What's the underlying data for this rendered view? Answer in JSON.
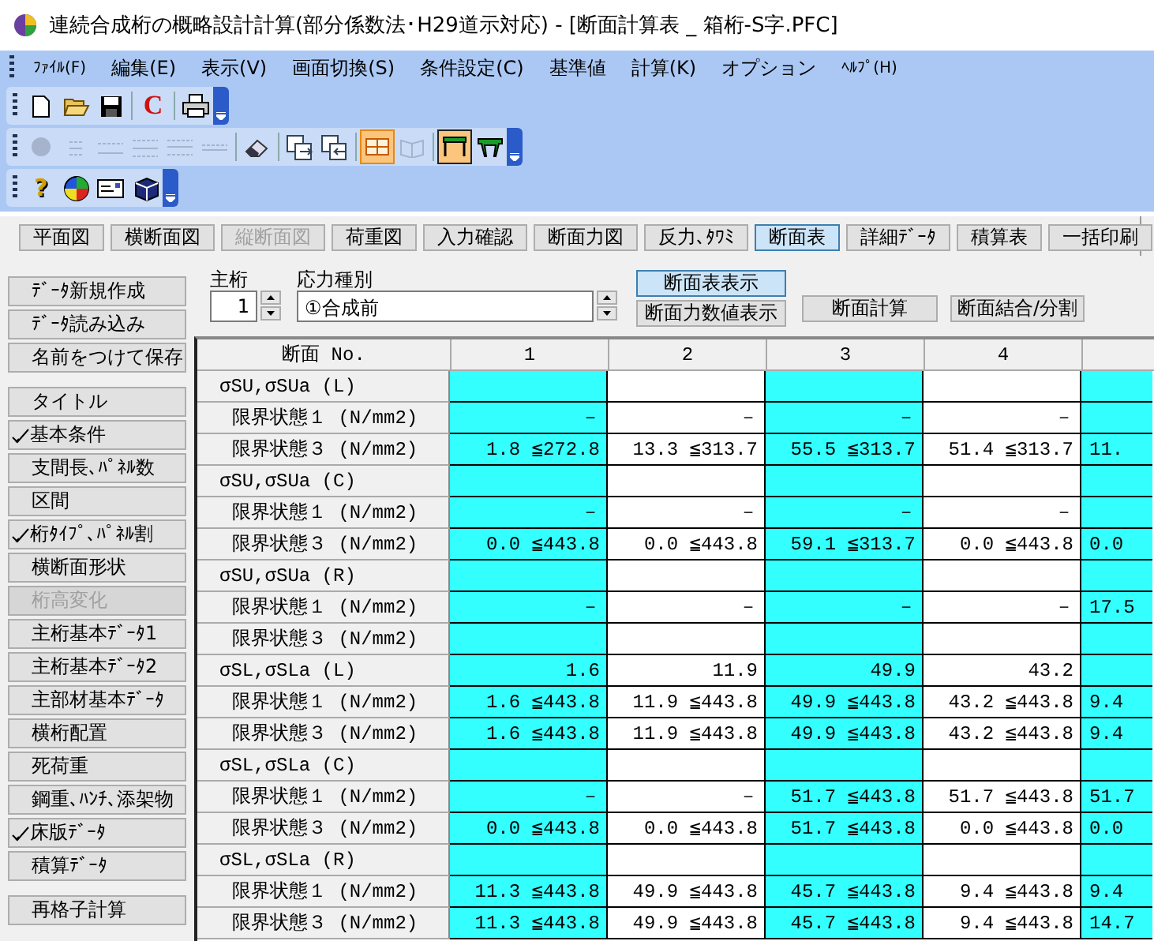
{
  "window": {
    "title": "連続合成桁の概略設計計算(部分係数法･H29道示対応) - [断面計算表 _ 箱桁-S字.PFC]"
  },
  "menu": [
    "ﾌｧｲﾙ(F)",
    "編集(E)",
    "表示(V)",
    "画面切換(S)",
    "条件設定(C)",
    "基準値",
    "計算(K)",
    "オプション",
    "ﾍﾙﾌﾟ(H)"
  ],
  "toolbars": [
    {
      "buttons": [
        {
          "kind": "new",
          "selected": false,
          "disabled": false
        },
        {
          "kind": "open",
          "selected": false,
          "disabled": false
        },
        {
          "kind": "save",
          "selected": false,
          "disabled": false
        },
        {
          "kind": "separator"
        },
        {
          "kind": "letter",
          "text": "C",
          "selected": false,
          "disabled": false
        },
        {
          "kind": "separator"
        },
        {
          "kind": "print",
          "selected": false,
          "disabled": false
        }
      ]
    },
    {
      "buttons": [
        {
          "kind": "circle",
          "selected": false,
          "disabled": true
        },
        {
          "kind": "lines-a",
          "selected": false,
          "disabled": true
        },
        {
          "kind": "lines-b",
          "selected": false,
          "disabled": true
        },
        {
          "kind": "lines-c",
          "selected": false,
          "disabled": true
        },
        {
          "kind": "lines-d",
          "selected": false,
          "disabled": true
        },
        {
          "kind": "lines-e",
          "selected": false,
          "disabled": true
        },
        {
          "kind": "separator"
        },
        {
          "kind": "eraser",
          "selected": false,
          "disabled": false
        },
        {
          "kind": "separator"
        },
        {
          "kind": "export",
          "selected": false,
          "disabled": false
        },
        {
          "kind": "import",
          "selected": false,
          "disabled": false
        },
        {
          "kind": "separator"
        },
        {
          "kind": "table",
          "selected": true,
          "disabled": false
        },
        {
          "kind": "book",
          "selected": false,
          "disabled": true
        },
        {
          "kind": "separator"
        },
        {
          "kind": "frame",
          "selected": true,
          "disabled": false
        },
        {
          "kind": "bridge",
          "selected": false,
          "disabled": false
        }
      ]
    },
    {
      "buttons": [
        {
          "kind": "letter",
          "text": "?",
          "selected": false,
          "disabled": false
        },
        {
          "kind": "palette",
          "selected": false,
          "disabled": false
        },
        {
          "kind": "card",
          "selected": false,
          "disabled": false
        },
        {
          "kind": "cube",
          "selected": false,
          "disabled": false
        }
      ]
    }
  ],
  "tabs": [
    {
      "label": "平面図",
      "selected": false,
      "disabled": false
    },
    {
      "label": "横断面図",
      "selected": false,
      "disabled": false
    },
    {
      "label": "縦断面図",
      "selected": false,
      "disabled": true
    },
    {
      "label": "荷重図",
      "selected": false,
      "disabled": false
    },
    {
      "label": "入力確認",
      "selected": false,
      "disabled": false
    },
    {
      "label": "断面力図",
      "selected": false,
      "disabled": false
    },
    {
      "label": "反力､ﾀﾜﾐ",
      "selected": false,
      "disabled": false
    },
    {
      "label": "断面表",
      "selected": true,
      "disabled": false
    },
    {
      "label": "詳細ﾃﾞｰﾀ",
      "selected": false,
      "disabled": false
    },
    {
      "label": "積算表",
      "selected": false,
      "disabled": false
    },
    {
      "label": "一括印刷",
      "selected": false,
      "disabled": false
    }
  ],
  "sidebar": {
    "groups": [
      [
        {
          "label": "ﾃﾞｰﾀ新規作成",
          "checked": false,
          "disabled": false
        },
        {
          "label": "ﾃﾞｰﾀ読み込み",
          "checked": false,
          "disabled": false
        },
        {
          "label": "名前をつけて保存",
          "checked": false,
          "disabled": false
        }
      ],
      [
        {
          "label": "タイトル",
          "checked": false,
          "disabled": false
        },
        {
          "label": "基本条件",
          "checked": true,
          "disabled": false
        },
        {
          "label": "支間長､ﾊﾟﾈﾙ数",
          "checked": false,
          "disabled": false
        },
        {
          "label": "区間",
          "checked": false,
          "disabled": false
        },
        {
          "label": "桁ﾀｲﾌﾟ､ﾊﾟﾈﾙ割",
          "checked": true,
          "disabled": false
        },
        {
          "label": "横断面形状",
          "checked": false,
          "disabled": false
        },
        {
          "label": "桁高変化",
          "checked": false,
          "disabled": true
        },
        {
          "label": "主桁基本ﾃﾞｰﾀ1",
          "checked": false,
          "disabled": false
        },
        {
          "label": "主桁基本ﾃﾞｰﾀ2",
          "checked": false,
          "disabled": false
        },
        {
          "label": "主部材基本ﾃﾞｰﾀ",
          "checked": false,
          "disabled": false
        },
        {
          "label": "横桁配置",
          "checked": false,
          "disabled": false
        },
        {
          "label": "死荷重",
          "checked": false,
          "disabled": false
        },
        {
          "label": "鋼重､ﾊﾝﾁ､添架物",
          "checked": false,
          "disabled": false
        },
        {
          "label": "床版ﾃﾞｰﾀ",
          "checked": true,
          "disabled": false
        },
        {
          "label": "積算ﾃﾞｰﾀ",
          "checked": false,
          "disabled": false
        }
      ],
      [
        {
          "label": "再格子計算",
          "checked": false,
          "disabled": false
        }
      ]
    ]
  },
  "controls": {
    "girder_label": "主桁",
    "girder_value": "1",
    "stress_label": "応力種別",
    "stress_value": "①合成前",
    "buttons": [
      {
        "label": "断面表表示",
        "selected": true
      },
      {
        "label": "断面力数値表示",
        "selected": false
      },
      {
        "label": "断面計算",
        "selected": false
      },
      {
        "label": "断面結合/分割",
        "selected": false
      }
    ]
  },
  "table": {
    "corner": "断面 No.",
    "columns": [
      {
        "label": "1",
        "shaded": true
      },
      {
        "label": "2",
        "shaded": false
      },
      {
        "label": "3",
        "shaded": true
      },
      {
        "label": "4",
        "shaded": false
      },
      {
        "shaded": true
      }
    ],
    "rows": [
      {
        "kind": "group",
        "label": "σSU,σSUa (L)",
        "cells": [
          "",
          "",
          "",
          "",
          ""
        ]
      },
      {
        "kind": "item",
        "label": "限界状態１ (N/mm2)",
        "cells": [
          "－",
          "－",
          "－",
          "－",
          ""
        ]
      },
      {
        "kind": "item",
        "label": "限界状態３ (N/mm2)",
        "cells": [
          "1.8 ≦272.8",
          "13.3 ≦313.7",
          "55.5 ≦313.7",
          "51.4 ≦313.7",
          "11."
        ]
      },
      {
        "kind": "group",
        "label": "σSU,σSUa (C)",
        "cells": [
          "",
          "",
          "",
          "",
          ""
        ]
      },
      {
        "kind": "item",
        "label": "限界状態１ (N/mm2)",
        "cells": [
          "－",
          "－",
          "－",
          "－",
          ""
        ]
      },
      {
        "kind": "item",
        "label": "限界状態３ (N/mm2)",
        "cells": [
          "0.0 ≦443.8",
          "0.0 ≦443.8",
          "59.1 ≦313.7",
          "0.0 ≦443.8",
          "0.0"
        ]
      },
      {
        "kind": "group",
        "label": "σSU,σSUa (R)",
        "cells": [
          "",
          "",
          "",
          "",
          ""
        ]
      },
      {
        "kind": "item",
        "label": "限界状態１ (N/mm2)",
        "cells": [
          "－",
          "－",
          "－",
          "－",
          "17.5"
        ]
      },
      {
        "kind": "item",
        "label": "限界状態３ (N/mm2)",
        "cells": [
          "",
          "",
          "",
          "",
          ""
        ]
      },
      {
        "kind": "group",
        "label": "σSL,σSLa (L)",
        "cells": [
          "1.6",
          "11.9",
          "49.9",
          "43.2",
          ""
        ]
      },
      {
        "kind": "item",
        "label": "限界状態１ (N/mm2)",
        "cells": [
          "1.6 ≦443.8",
          "11.9 ≦443.8",
          "49.9 ≦443.8",
          "43.2 ≦443.8",
          "9.4"
        ]
      },
      {
        "kind": "item",
        "label": "限界状態３ (N/mm2)",
        "cells": [
          "1.6 ≦443.8",
          "11.9 ≦443.8",
          "49.9 ≦443.8",
          "43.2 ≦443.8",
          "9.4"
        ]
      },
      {
        "kind": "group",
        "label": "σSL,σSLa (C)",
        "cells": [
          "",
          "",
          "",
          "",
          ""
        ]
      },
      {
        "kind": "item",
        "label": "限界状態１ (N/mm2)",
        "cells": [
          "－",
          "－",
          "51.7 ≦443.8",
          "51.7 ≦443.8",
          "51.7"
        ]
      },
      {
        "kind": "item",
        "label": "限界状態３ (N/mm2)",
        "cells": [
          "0.0 ≦443.8",
          "0.0 ≦443.8",
          "51.7 ≦443.8",
          "0.0 ≦443.8",
          "0.0"
        ]
      },
      {
        "kind": "group",
        "label": "σSL,σSLa (R)",
        "cells": [
          "",
          "",
          "",
          "",
          ""
        ]
      },
      {
        "kind": "item",
        "label": "限界状態１ (N/mm2)",
        "cells": [
          "11.3 ≦443.8",
          "49.9 ≦443.8",
          "45.7 ≦443.8",
          "9.4 ≦443.8",
          "9.4"
        ]
      },
      {
        "kind": "item",
        "label": "限界状態３ (N/mm2)",
        "cells": [
          "11.3 ≦443.8",
          "49.9 ≦443.8",
          "45.7 ≦443.8",
          "9.4 ≦443.8",
          "14.7"
        ]
      }
    ]
  }
}
